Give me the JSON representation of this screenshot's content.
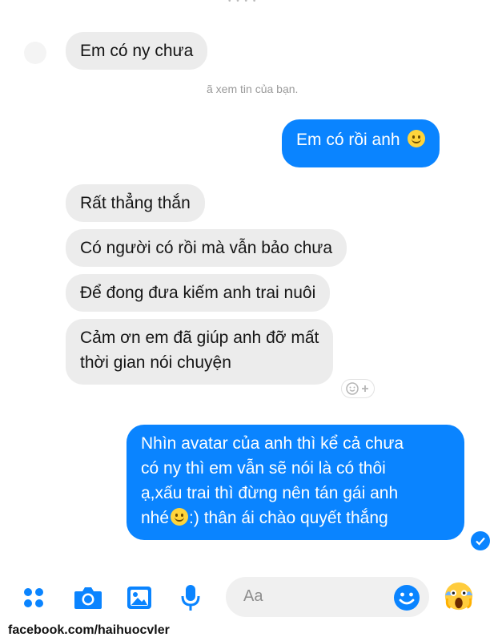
{
  "thread": {
    "messages": [
      {
        "direction": "incoming",
        "text": "Em có ny chưa"
      },
      {
        "direction": "outgoing",
        "text": "Em có rồi anh",
        "emoji": "smile-emoji"
      },
      {
        "direction": "incoming",
        "text": "Rất thẳng thắn"
      },
      {
        "direction": "incoming",
        "text": "Có người có rồi mà vẫn bảo chưa"
      },
      {
        "direction": "incoming",
        "text": "Để đong đưa kiếm anh trai nuôi"
      },
      {
        "direction": "incoming",
        "text_line1": "Cảm ơn em đã giúp anh đỡ mất",
        "text_line2": "thời gian nói chuyện"
      },
      {
        "direction": "outgoing",
        "text_line1": "Nhìn avatar của anh thì kể cả chưa",
        "text_line2": "có ny thì em vẫn sẽ nói là có thôi",
        "text_line3": "ạ,xấu trai thì đừng nên tán gái anh",
        "text_line4_a": "nhé",
        "text_line4_b": ":) thân ái chào quyết thắng"
      }
    ],
    "seen_text": "ã xem tin của bạn.",
    "reaction_add_icon": "add-reaction-icon"
  },
  "composer": {
    "placeholder": "Aa",
    "icons": [
      "menu-dots-icon",
      "camera-icon",
      "image-icon",
      "microphone-icon",
      "emoji-icon",
      "scream-emoji-icon"
    ]
  },
  "footer": {
    "watermark": "facebook.com/haihuocvler"
  },
  "colors": {
    "accent": "#0a84ff",
    "incoming_bubble": "#ececec"
  }
}
